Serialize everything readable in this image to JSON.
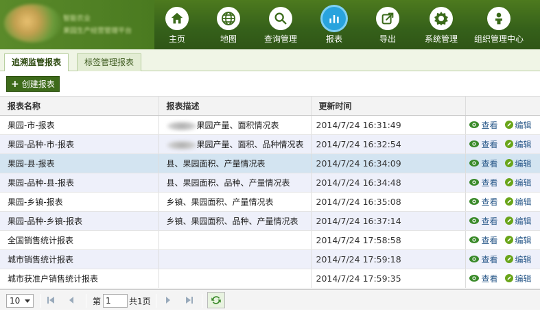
{
  "header": {
    "logo_line1": "智能农业",
    "logo_line2": "果园生产经营管理平台",
    "nav": [
      {
        "label": "主页",
        "icon": "home-icon"
      },
      {
        "label": "地图",
        "icon": "globe-icon"
      },
      {
        "label": "查询管理",
        "icon": "search-icon"
      },
      {
        "label": "报表",
        "icon": "bar-chart-icon",
        "active": true
      },
      {
        "label": "导出",
        "icon": "export-icon"
      },
      {
        "label": "系统管理",
        "icon": "gear-icon"
      },
      {
        "label": "组织管理中心",
        "icon": "user-icon"
      }
    ]
  },
  "tabs": [
    {
      "label": "追溯监管报表",
      "active": true
    },
    {
      "label": "标签管理报表",
      "active": false
    }
  ],
  "toolbar": {
    "create_label": "创建报表"
  },
  "table": {
    "headers": [
      "报表名称",
      "报表描述",
      "更新时间",
      ""
    ],
    "view_label": "查看",
    "edit_label": "编辑",
    "rows": [
      {
        "name": "果园-市-报表",
        "desc": "果园产量、面积情况表",
        "blurred": true,
        "time": "2014/7/24 16:31:49"
      },
      {
        "name": "果园-品种-市-报表",
        "desc": "果园产量、面积、品种情况表",
        "blurred": true,
        "time": "2014/7/24 16:32:54"
      },
      {
        "name": "果园-县-报表",
        "desc": "县、果园面积、产量情况表",
        "blurred": false,
        "time": "2014/7/24 16:34:09",
        "selected": true
      },
      {
        "name": "果园-品种-县-报表",
        "desc": "县、果园面积、品种、产量情况表",
        "blurred": false,
        "time": "2014/7/24 16:34:48"
      },
      {
        "name": "果园-乡镇-报表",
        "desc": "乡镇、果园面积、产量情况表",
        "blurred": false,
        "time": "2014/7/24 16:35:08"
      },
      {
        "name": "果园-品种-乡镇-报表",
        "desc": "乡镇、果园面积、品种、产量情况表",
        "blurred": false,
        "time": "2014/7/24 16:37:14"
      },
      {
        "name": "全国销售统计报表",
        "desc": "",
        "blurred": false,
        "time": "2014/7/24 17:58:58"
      },
      {
        "name": "城市销售统计报表",
        "desc": "",
        "blurred": false,
        "time": "2014/7/24 17:59:18"
      },
      {
        "name": "城市获准户销售统计报表",
        "desc": "",
        "blurred": false,
        "time": "2014/7/24 17:59:35"
      }
    ]
  },
  "pager": {
    "page_size": "10",
    "page_prefix": "第",
    "page_value": "1",
    "page_total": "共1页"
  }
}
